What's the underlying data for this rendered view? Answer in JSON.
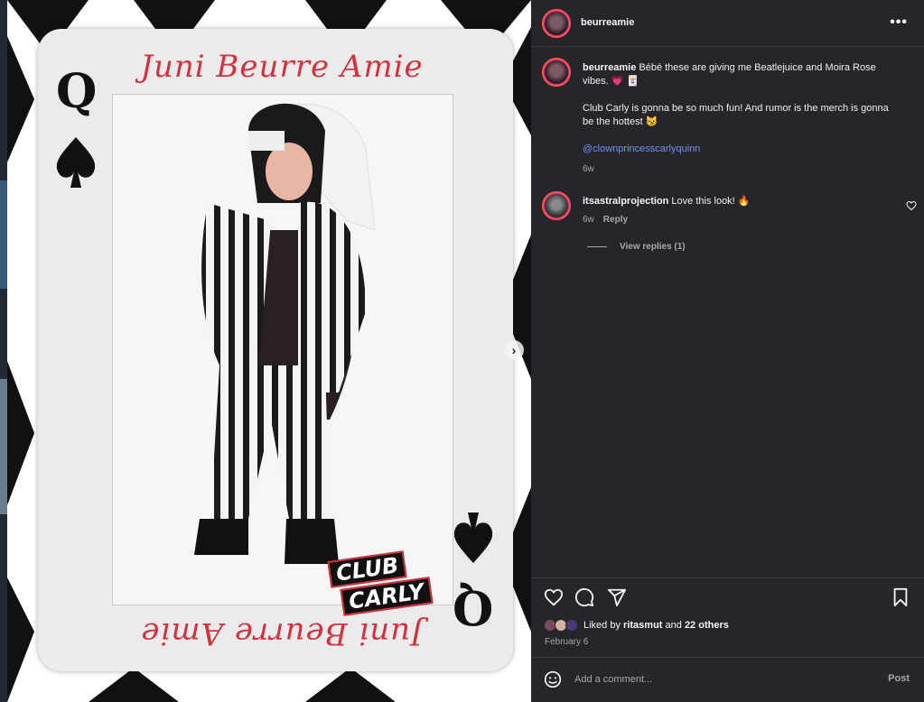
{
  "card": {
    "name": "Juni Beurre Amie",
    "rank": "Q",
    "suit_icon": "spade-icon",
    "logo_line1": "CLUB",
    "logo_line2": "CARLY",
    "name_color": "#d0333d"
  },
  "carousel": {
    "next_icon": "chevron-right-icon",
    "slide_count": 5,
    "active_slide": 1
  },
  "header": {
    "username": "beurreamie",
    "more_icon": "more-horizontal-icon"
  },
  "caption": {
    "username": "beurreamie",
    "line1": "Bébé these are giving me Beatlejuice and Moira Rose vibes. 💗 🃏",
    "line2": "Club Carly is gonna be so much fun! And rumor is the merch is gonna be the hottest 😼",
    "mention": "@clownprincesscarlyquinn",
    "time": "6w"
  },
  "comments": [
    {
      "username": "itsastralprojection",
      "text": "Love this look! 🔥",
      "time": "6w",
      "reply_label": "Reply"
    }
  ],
  "view_replies": "View replies (1)",
  "actions": {
    "like_icon": "heart-icon",
    "comment_icon": "comment-icon",
    "share_icon": "share-icon",
    "save_icon": "bookmark-icon"
  },
  "likes": {
    "prefix": "Liked by",
    "user": "ritasmut",
    "and": "and",
    "others": "22 others"
  },
  "date": "February 6",
  "add_comment": {
    "placeholder": "Add a comment...",
    "post_label": "Post",
    "emoji_icon": "emoji-icon"
  }
}
